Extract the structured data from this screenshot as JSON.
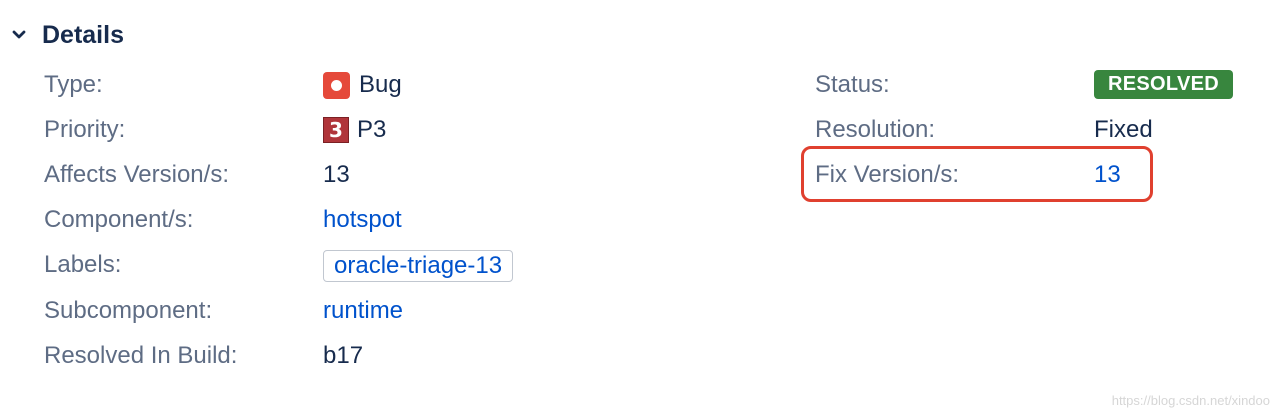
{
  "section": {
    "title": "Details"
  },
  "left_fields": {
    "type": {
      "label": "Type:",
      "value": "Bug",
      "icon": "bug-icon"
    },
    "priority": {
      "label": "Priority:",
      "value": "P3",
      "icon_text": "3"
    },
    "affects_version": {
      "label": "Affects Version/s:",
      "value": "13"
    },
    "component": {
      "label": "Component/s:",
      "value": "hotspot"
    },
    "labels": {
      "label": "Labels:",
      "value": "oracle-triage-13"
    },
    "subcomponent": {
      "label": "Subcomponent:",
      "value": "runtime"
    },
    "resolved_in_build": {
      "label": "Resolved In Build:",
      "value": "b17"
    }
  },
  "right_fields": {
    "status": {
      "label": "Status:",
      "value": "RESOLVED"
    },
    "resolution": {
      "label": "Resolution:",
      "value": "Fixed"
    },
    "fix_version": {
      "label": "Fix Version/s:",
      "value": "13"
    }
  },
  "colors": {
    "status_lozenge": "#38863e",
    "highlight_box": "#e0402f",
    "link": "#0052cc",
    "bug_icon": "#e5493a",
    "priority_icon": "#b0353a"
  },
  "watermark": "https://blog.csdn.net/xindoo"
}
